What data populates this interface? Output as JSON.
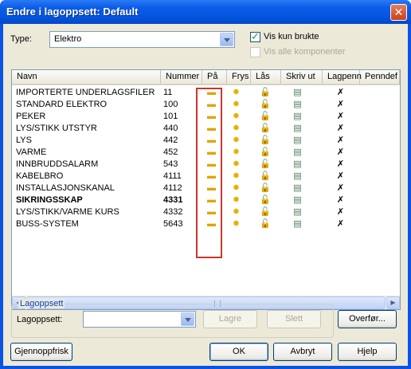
{
  "window": {
    "title": "Endre i lagoppsett: Default",
    "close_glyph": "✕"
  },
  "type": {
    "label": "Type:",
    "value": "Elektro"
  },
  "checkboxes": {
    "vis_kun_brukte": {
      "label": "Vis kun brukte",
      "checked": true
    },
    "vis_alle_komponenter": {
      "label": "Vis alle komponenter",
      "checked": false,
      "disabled": true
    }
  },
  "table": {
    "columns": [
      "Navn",
      "Nummer",
      "På",
      "Frys",
      "Lås",
      "Skriv ut",
      "Lagpenn",
      "Penndef"
    ],
    "rows": [
      {
        "navn": "IMPORTERTE UNDERLAGSFILER",
        "nummer": "11"
      },
      {
        "navn": "STANDARD ELEKTRO",
        "nummer": "100"
      },
      {
        "navn": "PEKER",
        "nummer": "101"
      },
      {
        "navn": "LYS/STIKK UTSTYR",
        "nummer": "440"
      },
      {
        "navn": "LYS",
        "nummer": "442"
      },
      {
        "navn": "VARME",
        "nummer": "452"
      },
      {
        "navn": "INNBRUDDSALARM",
        "nummer": "543"
      },
      {
        "navn": "KABELBRO",
        "nummer": "4111"
      },
      {
        "navn": "INSTALLASJONSKANAL",
        "nummer": "4112"
      },
      {
        "navn": "SIKRINGSSKAP",
        "nummer": "4331",
        "bold": true
      },
      {
        "navn": "LYS/STIKK/VARME KURS",
        "nummer": "4332"
      },
      {
        "navn": "BUSS-SYSTEM",
        "nummer": "5643"
      }
    ],
    "icons": {
      "on": "bulb-on-icon",
      "frys": "sun-icon",
      "las": "padlock-open-icon",
      "skriv_ut": "printer-icon",
      "lagpenn": "pen-icon"
    }
  },
  "lagoppsett_group": {
    "title": "Lagoppsett",
    "label": "Lagoppsett:",
    "value": "",
    "lagre": "Lagre",
    "slett": "Slett",
    "overfor": "Overfør..."
  },
  "footer": {
    "gjennoppfrisk": "Gjennoppfrisk",
    "ok": "OK",
    "avbryt": "Avbryt",
    "hjelp": "Hjelp"
  },
  "colors": {
    "title_bar": "#0a54e4",
    "highlight": "#c8372a",
    "dialog_bg": "#ece9d8"
  }
}
